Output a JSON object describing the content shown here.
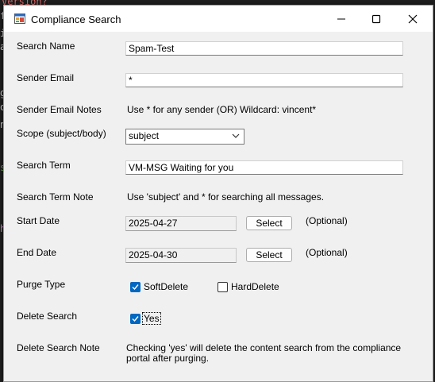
{
  "background": {
    "line1": "Version?",
    "line2": "fo",
    "line3": "ig",
    "line4": "ar",
    "line5": "g",
    "line6": "ol",
    "line7": "n/",
    "line8": "si",
    "line9": "he"
  },
  "window": {
    "title": "Compliance Search",
    "icon": "app-window-icon",
    "minimize_icon": "minimize-icon",
    "maximize_icon": "maximize-icon",
    "close_icon": "close-icon"
  },
  "form": {
    "search_name_label": "Search Name",
    "search_name_value": "Spam-Test",
    "sender_email_label": "Sender Email",
    "sender_email_value": "*",
    "sender_notes_label": "Sender Email Notes",
    "sender_notes_text": "Use * for any sender (OR) Wildcard: vincent*",
    "scope_label": "Scope (subject/body)",
    "scope_value": "subject",
    "search_term_label": "Search Term",
    "search_term_value": "VM-MSG Waiting for you",
    "search_term_note_label": "Search Term Note",
    "search_term_note_text": "Use 'subject' and  * for searching all messages.",
    "start_date_label": "Start Date",
    "start_date_value": "2025-04-27",
    "start_select": "Select",
    "start_optional": "(Optional)",
    "end_date_label": "End Date",
    "end_date_value": "2025-04-30",
    "end_select": "Select",
    "end_optional": "(Optional)",
    "purge_type_label": "Purge Type",
    "soft_delete_label": "SoftDelete",
    "soft_delete_checked": true,
    "hard_delete_label": "HardDelete",
    "hard_delete_checked": false,
    "delete_search_label": "Delete Search",
    "yes_label": "Yes",
    "yes_checked": true,
    "delete_note_label": "Delete Search Note",
    "delete_note_line1": "Checking 'yes' will delete the content search from the compliance",
    "delete_note_line2": "portal after purging."
  },
  "colors": {
    "accent": "#0067c0",
    "window_bg": "#f0f0f0"
  }
}
